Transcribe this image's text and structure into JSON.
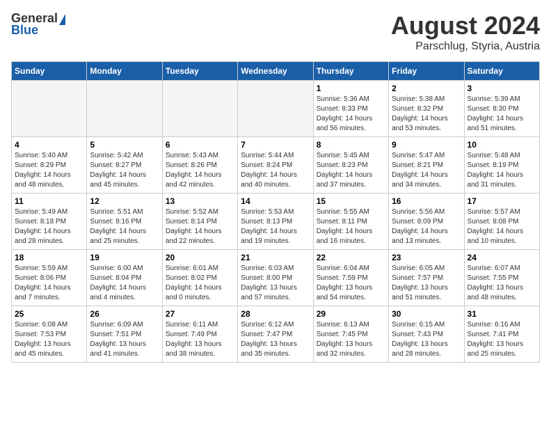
{
  "header": {
    "logo_general": "General",
    "logo_blue": "Blue",
    "month_title": "August 2024",
    "location": "Parschlug, Styria, Austria"
  },
  "weekdays": [
    "Sunday",
    "Monday",
    "Tuesday",
    "Wednesday",
    "Thursday",
    "Friday",
    "Saturday"
  ],
  "weeks": [
    [
      {
        "day": "",
        "info": ""
      },
      {
        "day": "",
        "info": ""
      },
      {
        "day": "",
        "info": ""
      },
      {
        "day": "",
        "info": ""
      },
      {
        "day": "1",
        "info": "Sunrise: 5:36 AM\nSunset: 8:33 PM\nDaylight: 14 hours\nand 56 minutes."
      },
      {
        "day": "2",
        "info": "Sunrise: 5:38 AM\nSunset: 8:32 PM\nDaylight: 14 hours\nand 53 minutes."
      },
      {
        "day": "3",
        "info": "Sunrise: 5:39 AM\nSunset: 8:30 PM\nDaylight: 14 hours\nand 51 minutes."
      }
    ],
    [
      {
        "day": "4",
        "info": "Sunrise: 5:40 AM\nSunset: 8:29 PM\nDaylight: 14 hours\nand 48 minutes."
      },
      {
        "day": "5",
        "info": "Sunrise: 5:42 AM\nSunset: 8:27 PM\nDaylight: 14 hours\nand 45 minutes."
      },
      {
        "day": "6",
        "info": "Sunrise: 5:43 AM\nSunset: 8:26 PM\nDaylight: 14 hours\nand 42 minutes."
      },
      {
        "day": "7",
        "info": "Sunrise: 5:44 AM\nSunset: 8:24 PM\nDaylight: 14 hours\nand 40 minutes."
      },
      {
        "day": "8",
        "info": "Sunrise: 5:45 AM\nSunset: 8:23 PM\nDaylight: 14 hours\nand 37 minutes."
      },
      {
        "day": "9",
        "info": "Sunrise: 5:47 AM\nSunset: 8:21 PM\nDaylight: 14 hours\nand 34 minutes."
      },
      {
        "day": "10",
        "info": "Sunrise: 5:48 AM\nSunset: 8:19 PM\nDaylight: 14 hours\nand 31 minutes."
      }
    ],
    [
      {
        "day": "11",
        "info": "Sunrise: 5:49 AM\nSunset: 8:18 PM\nDaylight: 14 hours\nand 28 minutes."
      },
      {
        "day": "12",
        "info": "Sunrise: 5:51 AM\nSunset: 8:16 PM\nDaylight: 14 hours\nand 25 minutes."
      },
      {
        "day": "13",
        "info": "Sunrise: 5:52 AM\nSunset: 8:14 PM\nDaylight: 14 hours\nand 22 minutes."
      },
      {
        "day": "14",
        "info": "Sunrise: 5:53 AM\nSunset: 8:13 PM\nDaylight: 14 hours\nand 19 minutes."
      },
      {
        "day": "15",
        "info": "Sunrise: 5:55 AM\nSunset: 8:11 PM\nDaylight: 14 hours\nand 16 minutes."
      },
      {
        "day": "16",
        "info": "Sunrise: 5:56 AM\nSunset: 8:09 PM\nDaylight: 14 hours\nand 13 minutes."
      },
      {
        "day": "17",
        "info": "Sunrise: 5:57 AM\nSunset: 8:08 PM\nDaylight: 14 hours\nand 10 minutes."
      }
    ],
    [
      {
        "day": "18",
        "info": "Sunrise: 5:59 AM\nSunset: 8:06 PM\nDaylight: 14 hours\nand 7 minutes."
      },
      {
        "day": "19",
        "info": "Sunrise: 6:00 AM\nSunset: 8:04 PM\nDaylight: 14 hours\nand 4 minutes."
      },
      {
        "day": "20",
        "info": "Sunrise: 6:01 AM\nSunset: 8:02 PM\nDaylight: 14 hours\nand 0 minutes."
      },
      {
        "day": "21",
        "info": "Sunrise: 6:03 AM\nSunset: 8:00 PM\nDaylight: 13 hours\nand 57 minutes."
      },
      {
        "day": "22",
        "info": "Sunrise: 6:04 AM\nSunset: 7:59 PM\nDaylight: 13 hours\nand 54 minutes."
      },
      {
        "day": "23",
        "info": "Sunrise: 6:05 AM\nSunset: 7:57 PM\nDaylight: 13 hours\nand 51 minutes."
      },
      {
        "day": "24",
        "info": "Sunrise: 6:07 AM\nSunset: 7:55 PM\nDaylight: 13 hours\nand 48 minutes."
      }
    ],
    [
      {
        "day": "25",
        "info": "Sunrise: 6:08 AM\nSunset: 7:53 PM\nDaylight: 13 hours\nand 45 minutes."
      },
      {
        "day": "26",
        "info": "Sunrise: 6:09 AM\nSunset: 7:51 PM\nDaylight: 13 hours\nand 41 minutes."
      },
      {
        "day": "27",
        "info": "Sunrise: 6:11 AM\nSunset: 7:49 PM\nDaylight: 13 hours\nand 38 minutes."
      },
      {
        "day": "28",
        "info": "Sunrise: 6:12 AM\nSunset: 7:47 PM\nDaylight: 13 hours\nand 35 minutes."
      },
      {
        "day": "29",
        "info": "Sunrise: 6:13 AM\nSunset: 7:45 PM\nDaylight: 13 hours\nand 32 minutes."
      },
      {
        "day": "30",
        "info": "Sunrise: 6:15 AM\nSunset: 7:43 PM\nDaylight: 13 hours\nand 28 minutes."
      },
      {
        "day": "31",
        "info": "Sunrise: 6:16 AM\nSunset: 7:41 PM\nDaylight: 13 hours\nand 25 minutes."
      }
    ]
  ]
}
